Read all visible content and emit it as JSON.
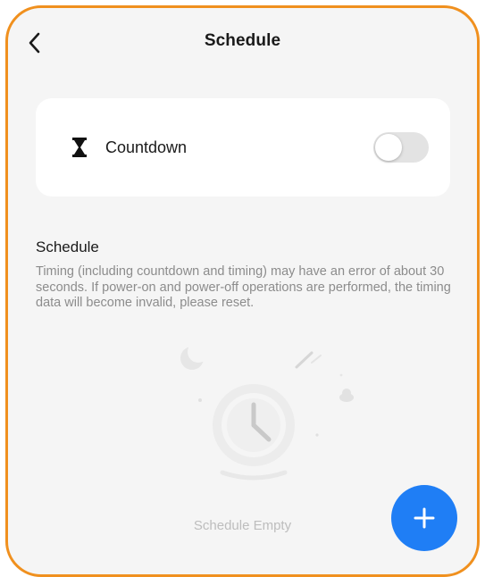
{
  "header": {
    "title": "Schedule",
    "back_icon": "chevron-left-icon"
  },
  "countdown": {
    "icon": "hourglass-icon",
    "label": "Countdown",
    "enabled": false
  },
  "schedule": {
    "title": "Schedule",
    "description": "Timing (including countdown and timing) may have an error of about 30 seconds. If power-on and power-off operations are performed, the timing data will become invalid, please reset.",
    "empty_text": "Schedule Empty"
  },
  "add_button": {
    "icon": "plus-icon",
    "color": "#1f7ef5"
  },
  "colors": {
    "frame_border": "#f0901e",
    "background": "#f5f5f5",
    "card": "#ffffff"
  }
}
